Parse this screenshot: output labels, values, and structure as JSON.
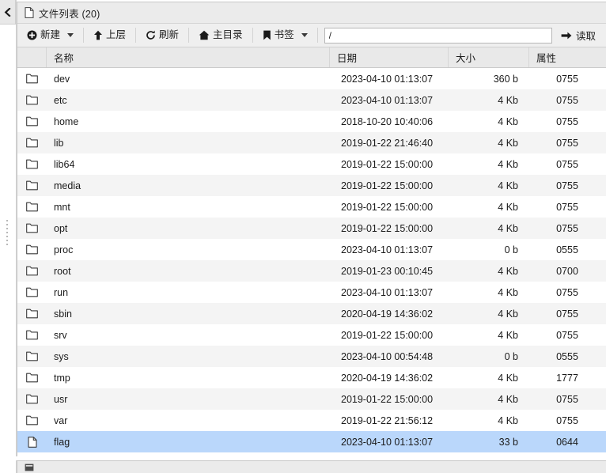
{
  "window": {
    "collapse_icon": "chevron-left-icon",
    "title": "文件列表 (20)",
    "title_icon": "document-icon"
  },
  "toolbar": {
    "new_label": "新建",
    "new_icon": "plus-circle-icon",
    "up_label": "上层",
    "up_icon": "arrow-up-icon",
    "refresh_label": "刷新",
    "refresh_icon": "refresh-icon",
    "home_label": "主目录",
    "home_icon": "home-icon",
    "bookmark_label": "书签",
    "bookmark_icon": "bookmark-icon",
    "path_value": "/",
    "path_placeholder": "/",
    "read_label": "读取",
    "read_icon": "arrow-right-icon"
  },
  "table": {
    "columns": [
      {
        "key": "icon",
        "label": ""
      },
      {
        "key": "name",
        "label": "名称"
      },
      {
        "key": "date",
        "label": "日期"
      },
      {
        "key": "size",
        "label": "大小"
      },
      {
        "key": "attr",
        "label": "属性"
      }
    ],
    "rows": [
      {
        "icon": "folder-icon",
        "name": "dev",
        "date": "2023-04-10 01:13:07",
        "size": "360 b",
        "attr": "0755",
        "selected": false
      },
      {
        "icon": "folder-icon",
        "name": "etc",
        "date": "2023-04-10 01:13:07",
        "size": "4 Kb",
        "attr": "0755",
        "selected": false
      },
      {
        "icon": "folder-icon",
        "name": "home",
        "date": "2018-10-20 10:40:06",
        "size": "4 Kb",
        "attr": "0755",
        "selected": false
      },
      {
        "icon": "folder-icon",
        "name": "lib",
        "date": "2019-01-22 21:46:40",
        "size": "4 Kb",
        "attr": "0755",
        "selected": false
      },
      {
        "icon": "folder-icon",
        "name": "lib64",
        "date": "2019-01-22 15:00:00",
        "size": "4 Kb",
        "attr": "0755",
        "selected": false
      },
      {
        "icon": "folder-icon",
        "name": "media",
        "date": "2019-01-22 15:00:00",
        "size": "4 Kb",
        "attr": "0755",
        "selected": false
      },
      {
        "icon": "folder-icon",
        "name": "mnt",
        "date": "2019-01-22 15:00:00",
        "size": "4 Kb",
        "attr": "0755",
        "selected": false
      },
      {
        "icon": "folder-icon",
        "name": "opt",
        "date": "2019-01-22 15:00:00",
        "size": "4 Kb",
        "attr": "0755",
        "selected": false
      },
      {
        "icon": "folder-icon",
        "name": "proc",
        "date": "2023-04-10 01:13:07",
        "size": "0 b",
        "attr": "0555",
        "selected": false
      },
      {
        "icon": "folder-icon",
        "name": "root",
        "date": "2019-01-23 00:10:45",
        "size": "4 Kb",
        "attr": "0700",
        "selected": false
      },
      {
        "icon": "folder-icon",
        "name": "run",
        "date": "2023-04-10 01:13:07",
        "size": "4 Kb",
        "attr": "0755",
        "selected": false
      },
      {
        "icon": "folder-icon",
        "name": "sbin",
        "date": "2020-04-19 14:36:02",
        "size": "4 Kb",
        "attr": "0755",
        "selected": false
      },
      {
        "icon": "folder-icon",
        "name": "srv",
        "date": "2019-01-22 15:00:00",
        "size": "4 Kb",
        "attr": "0755",
        "selected": false
      },
      {
        "icon": "folder-icon",
        "name": "sys",
        "date": "2023-04-10 00:54:48",
        "size": "0 b",
        "attr": "0555",
        "selected": false
      },
      {
        "icon": "folder-icon",
        "name": "tmp",
        "date": "2020-04-19 14:36:02",
        "size": "4 Kb",
        "attr": "1777",
        "selected": false
      },
      {
        "icon": "folder-icon",
        "name": "usr",
        "date": "2019-01-22 15:00:00",
        "size": "4 Kb",
        "attr": "0755",
        "selected": false
      },
      {
        "icon": "folder-icon",
        "name": "var",
        "date": "2019-01-22 21:56:12",
        "size": "4 Kb",
        "attr": "0755",
        "selected": false
      },
      {
        "icon": "file-icon",
        "name": "flag",
        "date": "2023-04-10 01:13:07",
        "size": "33 b",
        "attr": "0644",
        "selected": true
      }
    ]
  },
  "bottom_panel": {
    "title": "",
    "title_icon": "panel-icon"
  },
  "colors": {
    "selection": "#bad7fb",
    "row_alt": "#f4f4f4",
    "header": "#e9e9e9",
    "toolbar": "#efefef",
    "titlebar": "#ebebeb",
    "border": "#c8c8c8"
  }
}
